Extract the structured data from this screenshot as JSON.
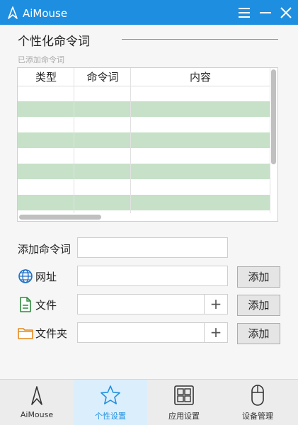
{
  "app": {
    "title": "AiMouse"
  },
  "section": {
    "title": "个性化命令词",
    "subtitle": "已添加命令词"
  },
  "table": {
    "columns": [
      "类型",
      "命令词",
      "内容"
    ]
  },
  "form": {
    "add_label": "添加命令词",
    "url_label": "网址",
    "file_label": "文件",
    "folder_label": "文件夹",
    "add_button": "添加",
    "plus": "+"
  },
  "nav": {
    "items": [
      {
        "label": "AiMouse"
      },
      {
        "label": "个性设置"
      },
      {
        "label": "应用设置"
      },
      {
        "label": "设备管理"
      }
    ],
    "active": "个性设置"
  },
  "colors": {
    "accent": "#1e8fe0",
    "row_green": "#c6e1c8"
  }
}
